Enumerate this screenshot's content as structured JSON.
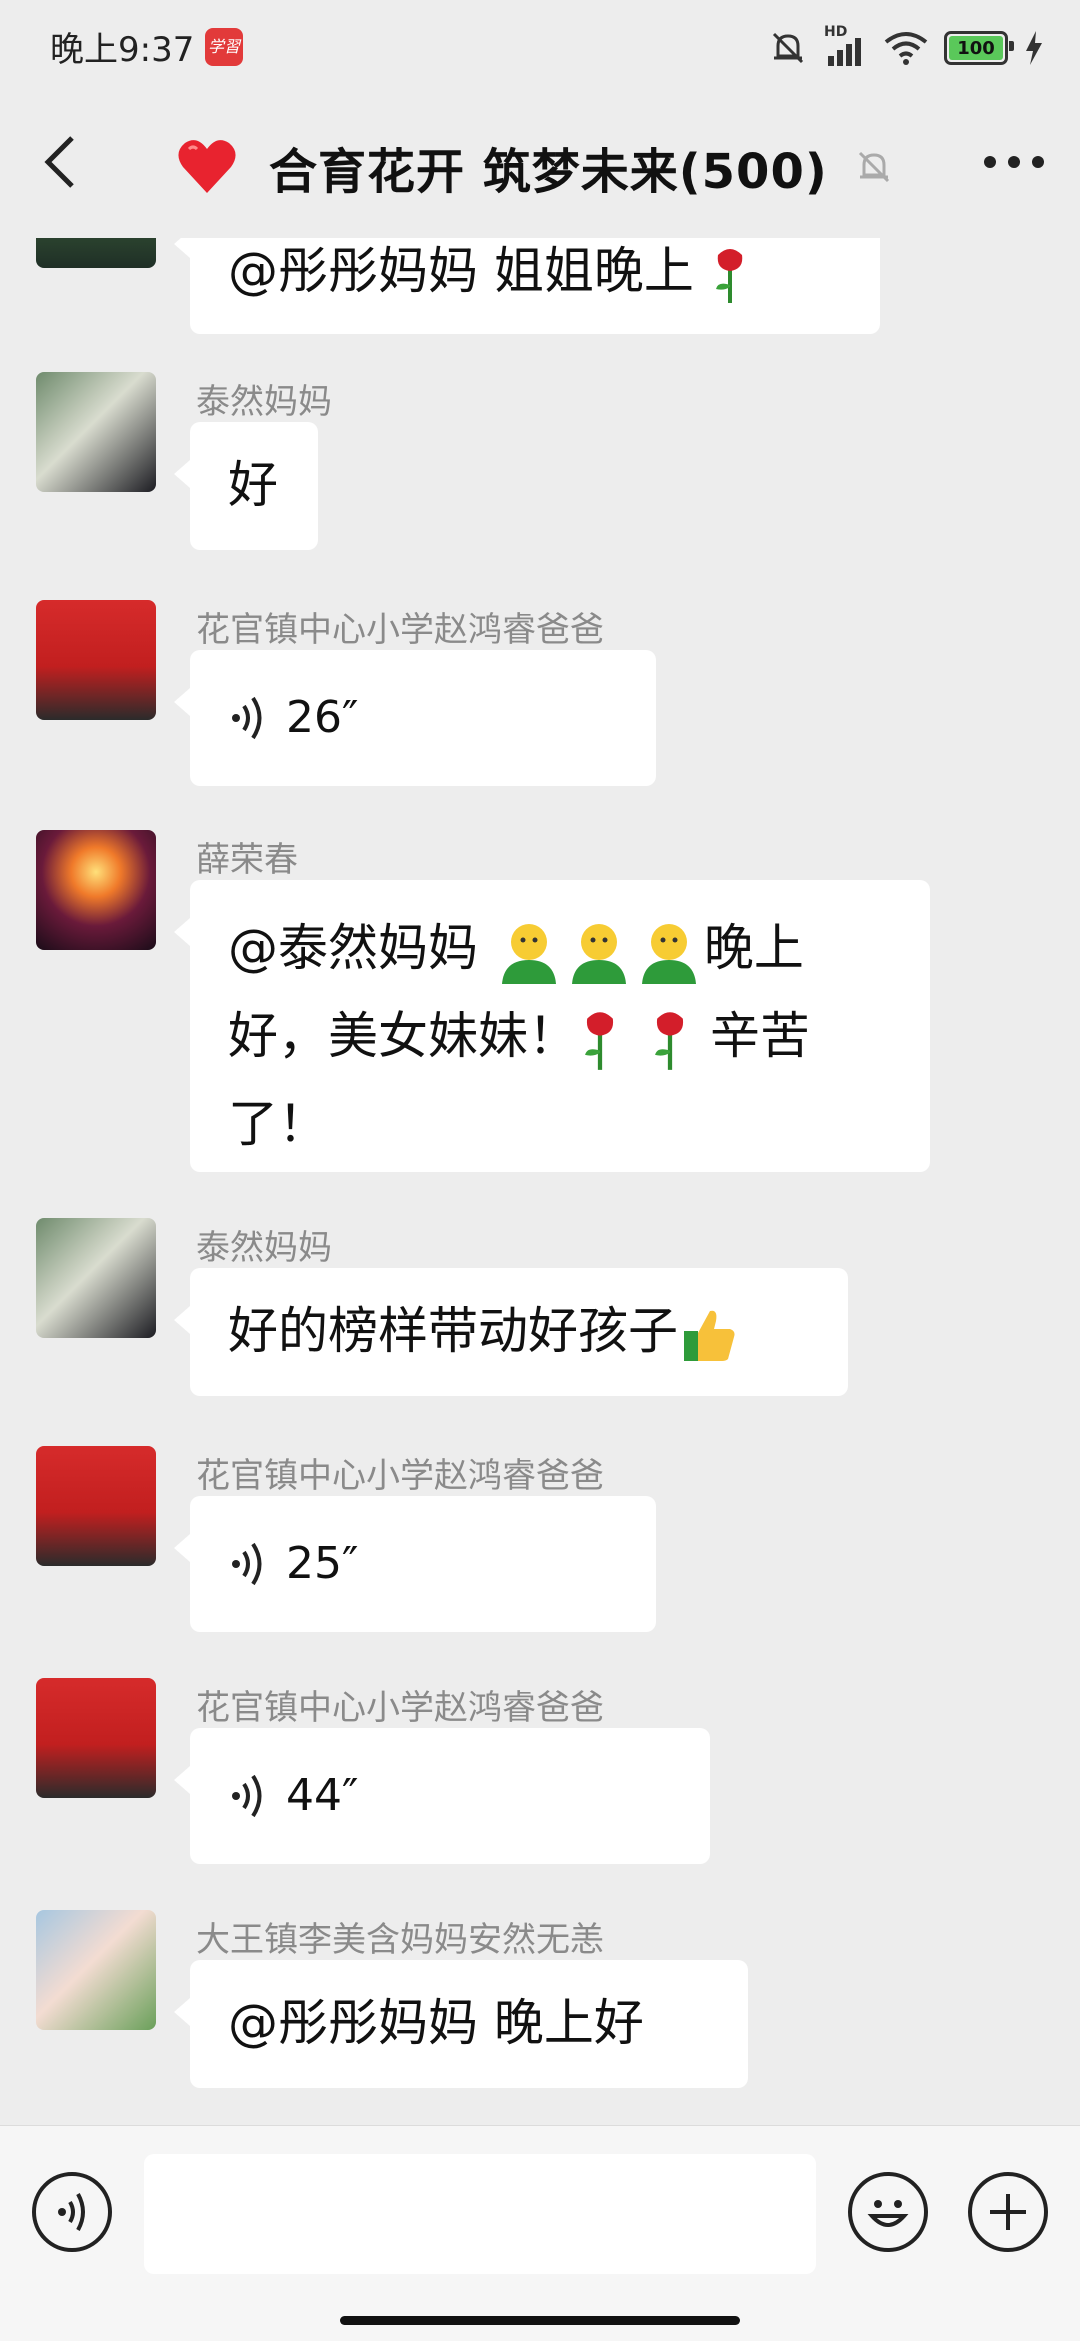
{
  "status_bar": {
    "time": "晚上9:37",
    "app_badge": "学習",
    "battery": "100",
    "network": "HD",
    "icons": [
      "mute-bell-icon",
      "signal-icon",
      "wifi-icon",
      "battery-icon",
      "charging-icon"
    ]
  },
  "header": {
    "title": "合育花开 筑梦未来(500)",
    "heart_icon": "heart-icon",
    "mute_icon": "mute-icon",
    "more_icon": "more-icon"
  },
  "messages": [
    {
      "type": "text",
      "sender": "",
      "text": "@彤彤妈妈  姐姐晚上",
      "emojis": [
        "rose"
      ]
    },
    {
      "type": "text",
      "sender": "泰然妈妈",
      "text": "好"
    },
    {
      "type": "voice",
      "sender": "花官镇中心小学赵鸿睿爸爸",
      "duration": "26″"
    },
    {
      "type": "text",
      "sender": "薛荣春",
      "text_parts": [
        "@泰然妈妈 ",
        "晚上",
        "好，美女妹妹！",
        "辛苦",
        "了！"
      ]
    },
    {
      "type": "text",
      "sender": "泰然妈妈",
      "text": "好的榜样带动好孩子",
      "emojis": [
        "thumbs-up"
      ]
    },
    {
      "type": "voice",
      "sender": "花官镇中心小学赵鸿睿爸爸",
      "duration": "25″"
    },
    {
      "type": "voice",
      "sender": "花官镇中心小学赵鸿睿爸爸",
      "duration": "44″"
    },
    {
      "type": "text",
      "sender": "大王镇李美含妈妈安然无恙",
      "text": "@彤彤妈妈  晚上好"
    }
  ],
  "input_bar": {
    "voice_icon": "voice-input-icon",
    "emoji_icon": "emoji-icon",
    "plus_icon": "plus-icon",
    "placeholder": ""
  },
  "colors": {
    "background": "#ededed",
    "bubble": "#ffffff",
    "sender_text": "#8a8a8a",
    "battery_fill": "#5ac85a"
  }
}
